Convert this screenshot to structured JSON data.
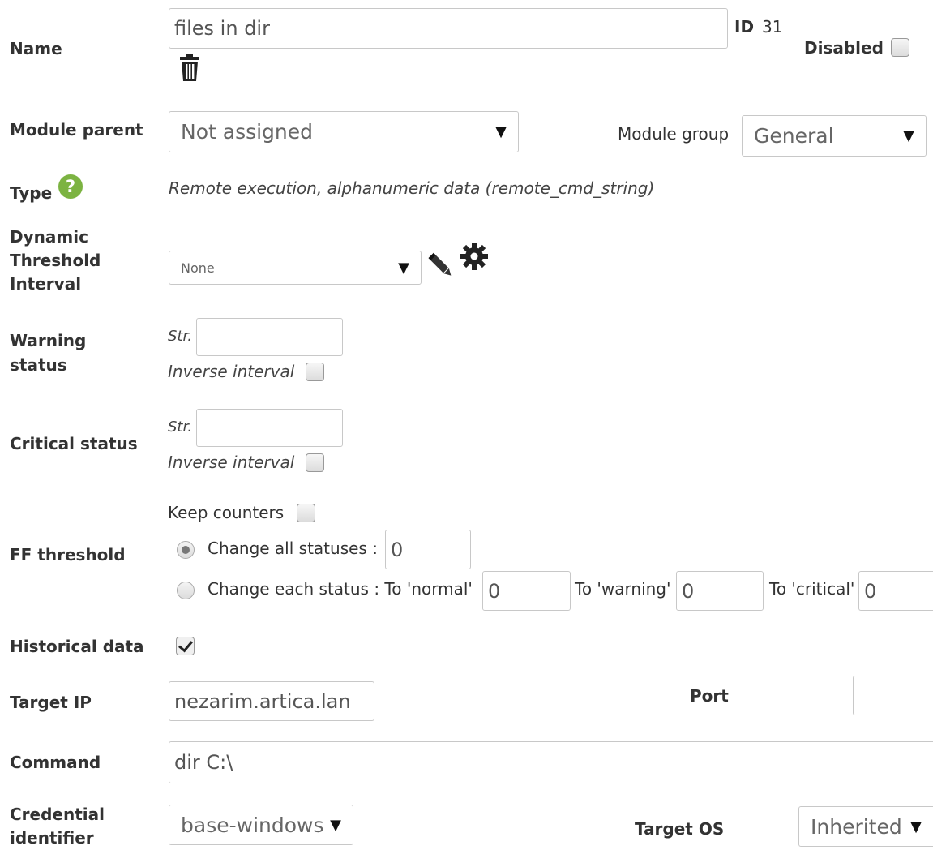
{
  "name": {
    "label": "Name",
    "value": "files in dir"
  },
  "id": {
    "label": "ID",
    "value": "31"
  },
  "disabled": {
    "label": "Disabled",
    "checked": false
  },
  "module_parent": {
    "label": "Module parent",
    "value": "Not assigned"
  },
  "module_group": {
    "label": "Module group",
    "value": "General"
  },
  "type": {
    "label": "Type",
    "help": "?",
    "value": "Remote execution, alphanumeric data (remote_cmd_string)"
  },
  "dynamic_threshold": {
    "label_lines": [
      "Dynamic",
      "Threshold",
      "Interval"
    ],
    "value": "None"
  },
  "warning": {
    "label_lines": [
      "Warning",
      "status"
    ],
    "str_label": "Str.",
    "str_value": "",
    "inverse_label": "Inverse interval",
    "inverse_checked": false
  },
  "critical": {
    "label": "Critical status",
    "str_label": "Str.",
    "str_value": "",
    "inverse_label": "Inverse interval",
    "inverse_checked": false
  },
  "ff": {
    "label": "FF threshold",
    "keep_counters_label": "Keep counters",
    "keep_counters_checked": false,
    "change_all_label": "Change all statuses :",
    "change_all_value": "0",
    "change_all_selected": true,
    "change_each_label": "Change each status : To 'normal'",
    "normal_value": "0",
    "to_warning_label": "To 'warning'",
    "warning_value": "0",
    "to_critical_label": "To 'critical'",
    "critical_value": "0"
  },
  "historical": {
    "label": "Historical data",
    "checked": true
  },
  "target_ip": {
    "label": "Target IP",
    "value": "nezarim.artica.lan"
  },
  "port": {
    "label": "Port",
    "value": ""
  },
  "command": {
    "label": "Command",
    "value": "dir C:\\"
  },
  "credential": {
    "label_lines": [
      "Credential",
      "identifier"
    ],
    "value": "base-windows"
  },
  "target_os": {
    "label": "Target OS",
    "value": "Inherited"
  },
  "icons": {
    "delete": "trash-icon",
    "edit": "pencil-icon",
    "settings": "gear-icon",
    "help": "help-icon"
  },
  "colors": {
    "help_green": "#7cb342"
  }
}
